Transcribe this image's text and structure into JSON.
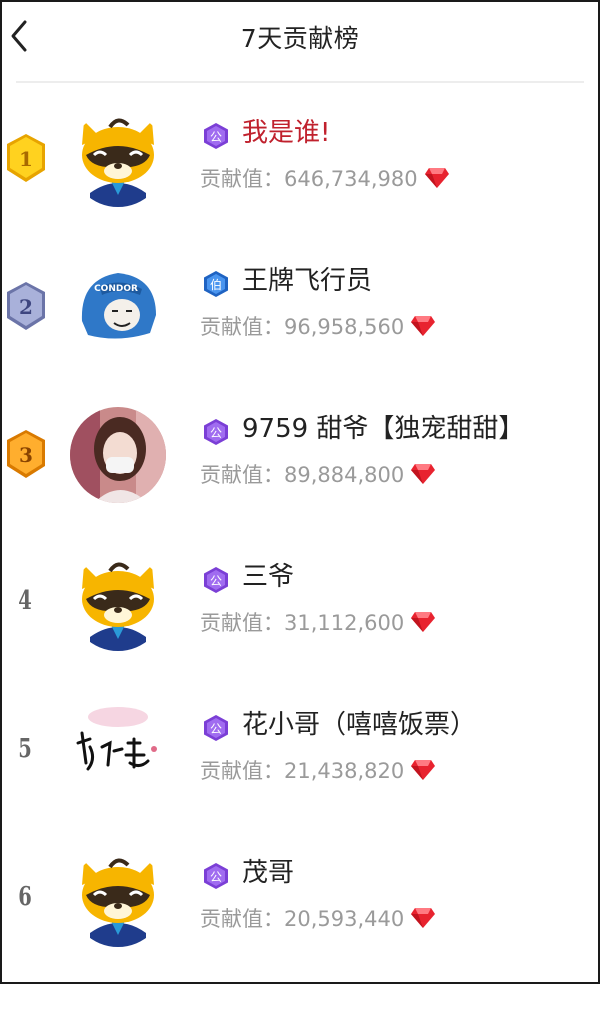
{
  "header": {
    "title": "7天贡献榜"
  },
  "contrib_label": "贡献值：",
  "rows": [
    {
      "rank": "1",
      "name": "我是谁!",
      "value": "646,734,980",
      "badge": "公",
      "avatar": "raccoon-mascot",
      "highlight": true
    },
    {
      "rank": "2",
      "name": "王牌飞行员",
      "value": "96,958,560",
      "badge": "伯",
      "avatar": "helmet-meme"
    },
    {
      "rank": "3",
      "name": "9759 甜爷【独宠甜甜】",
      "value": "89,884,800",
      "badge": "公",
      "avatar": "girl-photo"
    },
    {
      "rank": "4",
      "name": "三爷",
      "value": "31,112,600",
      "badge": "公",
      "avatar": "raccoon-mascot"
    },
    {
      "rank": "5",
      "name": "花小哥（嘻嘻饭票）",
      "value": "21,438,820",
      "badge": "公",
      "avatar": "calligraphy"
    },
    {
      "rank": "6",
      "name": "茂哥",
      "value": "20,593,440",
      "badge": "公",
      "avatar": "raccoon-mascot"
    }
  ],
  "colors": {
    "gold": "#f5b800",
    "silver": "#8d96c4",
    "bronze": "#f29a1f",
    "noble_purple": "#7b3fd6",
    "earl_blue": "#2f7fe0",
    "highlight": "#c0212d",
    "gem": "#e8232f"
  },
  "icons": {
    "back": "chevron-left-icon",
    "gem": "diamond-icon"
  }
}
